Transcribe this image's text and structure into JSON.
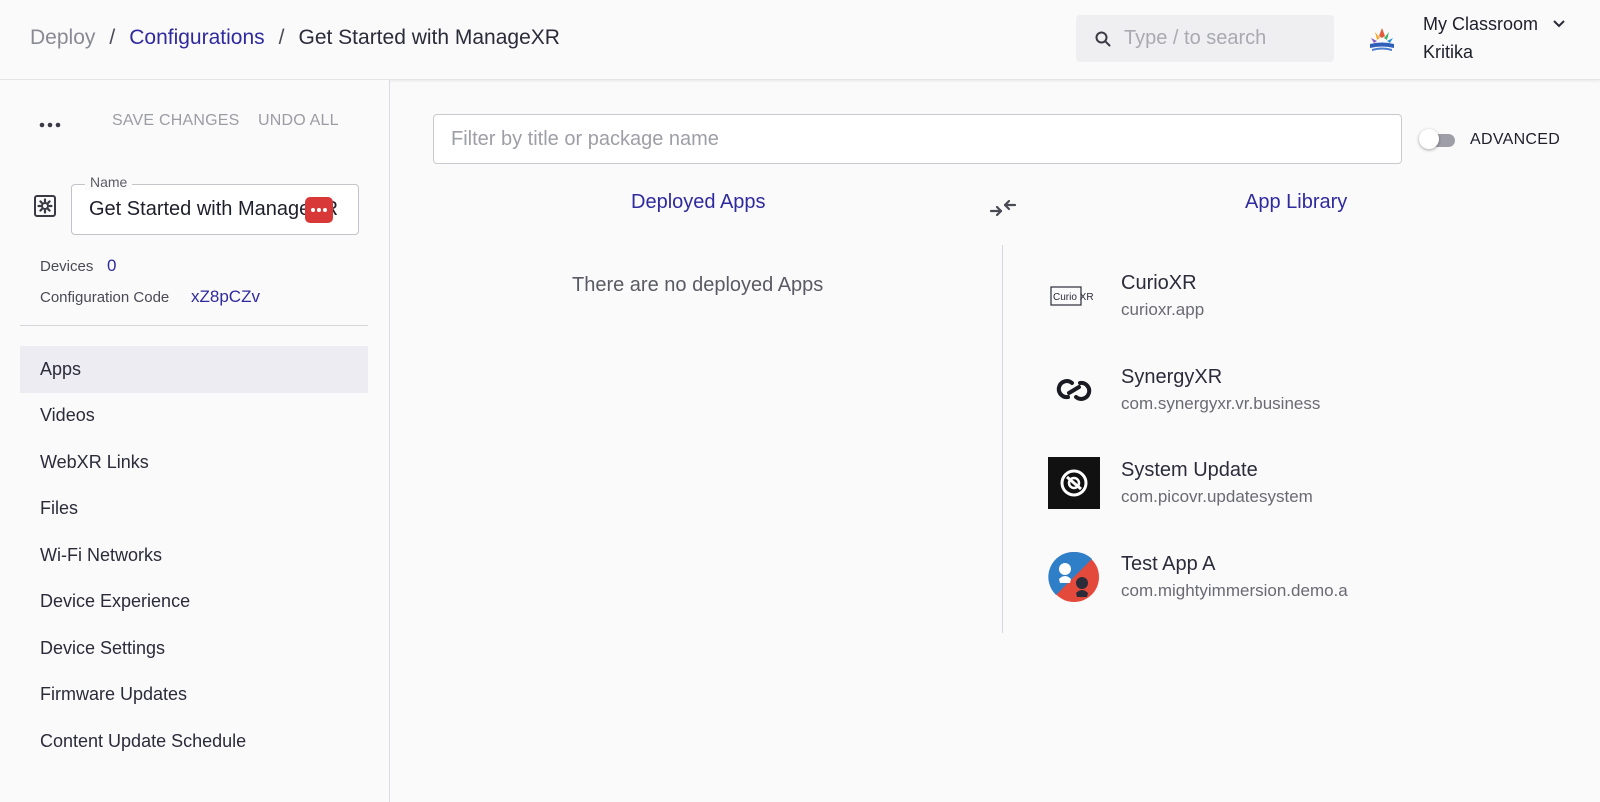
{
  "header": {
    "breadcrumb": {
      "root": "Deploy",
      "separator": "/",
      "link": "Configurations",
      "current": "Get Started with ManageXR"
    },
    "search": {
      "placeholder": "Type / to search",
      "icon": "search-icon"
    },
    "account": {
      "org": "My Classroom",
      "user": "Kritika",
      "icon": "classroom-logo-icon"
    }
  },
  "sidebar": {
    "actions": {
      "save": "SAVE CHANGES",
      "undo": "UNDO ALL",
      "more_icon": "more-horizontal-icon"
    },
    "name_field": {
      "legend": "Name",
      "value": "Get Started with ManageXR"
    },
    "devices": {
      "label": "Devices",
      "value": "0"
    },
    "config_code": {
      "label": "Configuration Code",
      "value": "xZ8pCZv"
    },
    "nav": [
      {
        "label": "Apps",
        "active": true
      },
      {
        "label": "Videos"
      },
      {
        "label": "WebXR Links"
      },
      {
        "label": "Files"
      },
      {
        "label": "Wi-Fi Networks"
      },
      {
        "label": "Device Experience"
      },
      {
        "label": "Device Settings"
      },
      {
        "label": "Firmware Updates"
      },
      {
        "label": "Content Update Schedule"
      }
    ]
  },
  "main": {
    "filter": {
      "placeholder": "Filter by title or package name"
    },
    "advanced": {
      "label": "ADVANCED",
      "enabled": false
    },
    "deployed": {
      "title": "Deployed Apps",
      "empty": "There are no deployed Apps"
    },
    "library": {
      "title": "App Library",
      "apps": [
        {
          "title": "CurioXR",
          "package": "curioxr.app",
          "icon": "curioxr-logo-icon",
          "icon_text": "Curio XR"
        },
        {
          "title": "SynergyXR",
          "package": "com.synergyxr.vr.business",
          "icon": "synergyxr-logo-icon"
        },
        {
          "title": "System Update",
          "package": "com.picovr.updatesystem",
          "icon": "system-update-icon"
        },
        {
          "title": "Test App A",
          "package": "com.mightyimmersion.demo.a",
          "icon": "test-app-icon"
        }
      ]
    }
  },
  "colors": {
    "accent": "#2f2a9e",
    "active_nav": "#ececf2",
    "background": "#fafafa",
    "password_manager": "#d93838"
  }
}
